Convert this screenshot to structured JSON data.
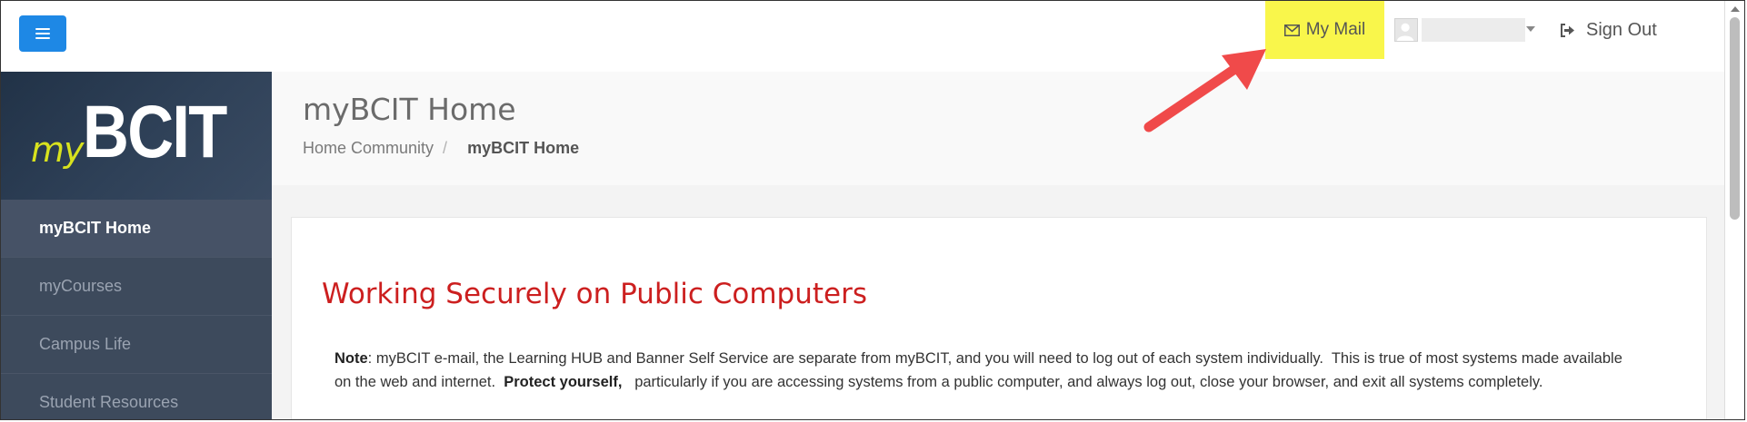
{
  "topbar": {
    "menu_icon": "hamburger-menu-icon",
    "mail_label": "My Mail",
    "mail_icon": "envelope-icon",
    "signout_label": "Sign Out",
    "signout_icon": "sign-out-icon",
    "highlight_color": "#f9f64b",
    "accent_color": "#1e88e5"
  },
  "annotation": {
    "arrow_color": "#f04a4a"
  },
  "logo": {
    "prefix": "my",
    "name": "BCIT"
  },
  "sidebar": {
    "items": [
      {
        "label": "myBCIT Home",
        "active": true
      },
      {
        "label": "myCourses",
        "active": false
      },
      {
        "label": "Campus Life",
        "active": false
      },
      {
        "label": "Student Resources",
        "active": false
      }
    ]
  },
  "page": {
    "title": "myBCIT Home",
    "breadcrumb": {
      "parent": "Home Community",
      "separator": "/",
      "current": "myBCIT Home"
    }
  },
  "content": {
    "heading": "Working Securely on Public Computers",
    "note_label": "Note",
    "note_text_1": ": myBCIT e-mail, the Learning HUB and Banner Self Service are separate from myBCIT, and you will need to log out of each system individually.  This is true of most systems made available on the web and internet.  ",
    "note_emphasis": "Protect yourself,",
    "note_text_2": "   particularly if you are accessing systems from a public computer, and always log out, close your browser, and exit all systems completely.",
    "heading_color": "#cc1f1f"
  }
}
